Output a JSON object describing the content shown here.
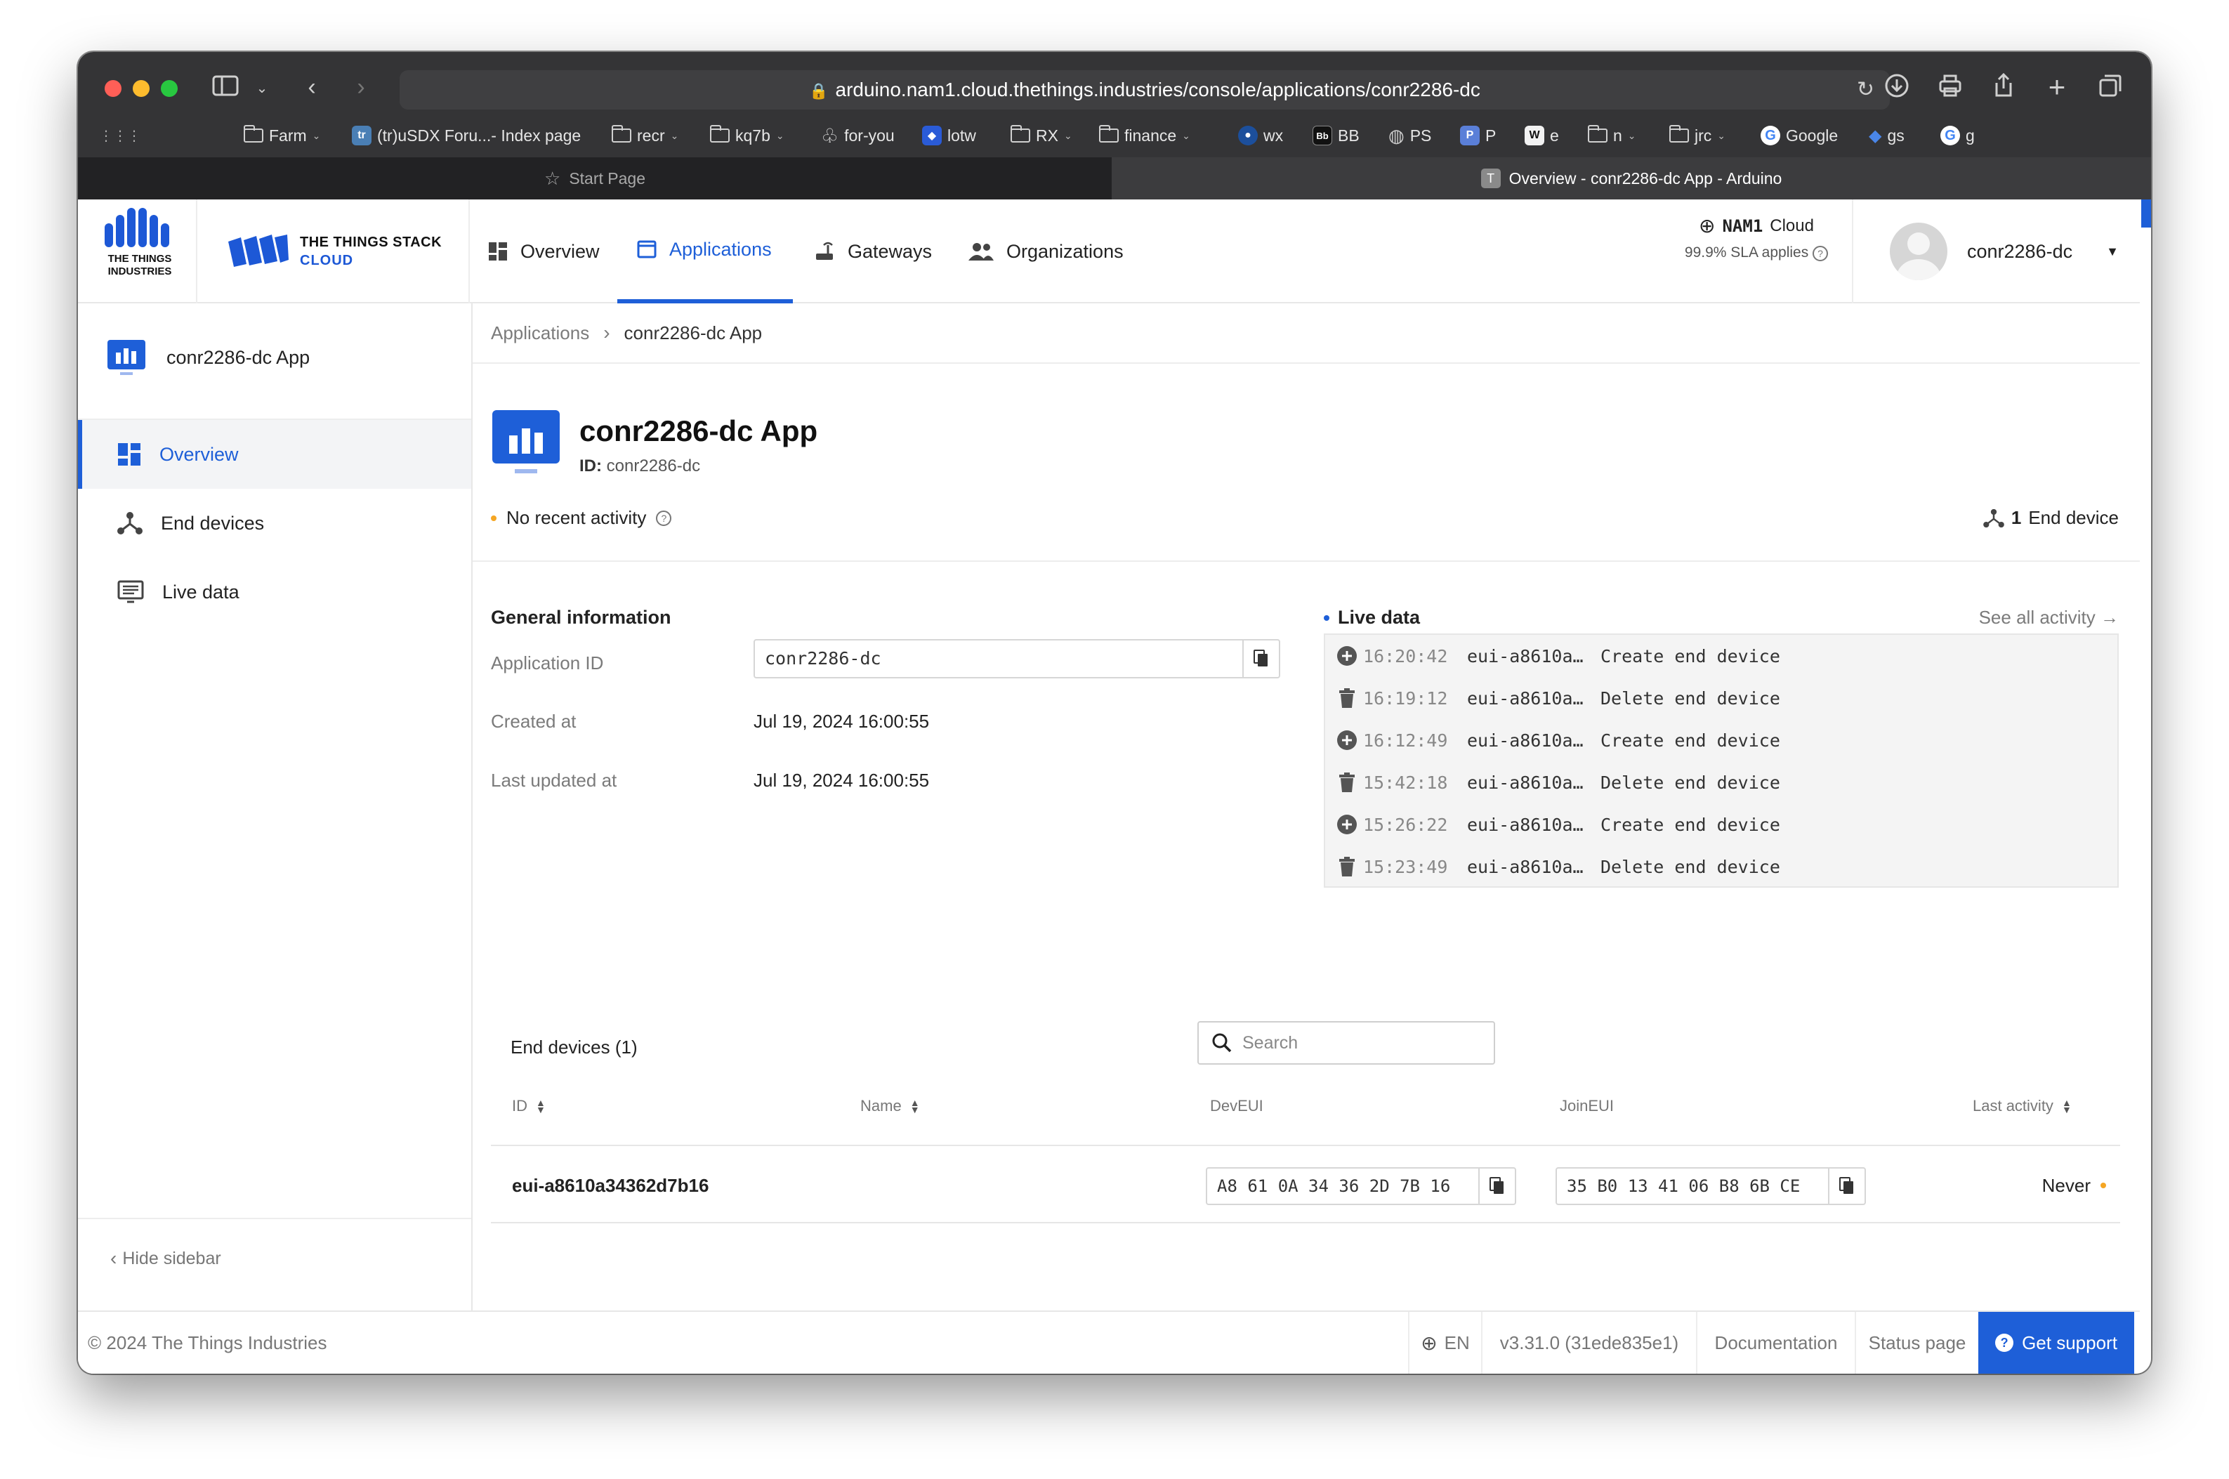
{
  "browser": {
    "url": "arduino.nam1.cloud.thethings.industries/console/applications/conr2286-dc",
    "bookmarks": [
      {
        "label": "Farm",
        "kind": "folder"
      },
      {
        "label": "(tr)uSDX Foru...- Index page",
        "kind": "site"
      },
      {
        "label": "recr",
        "kind": "folder"
      },
      {
        "label": "kq7b",
        "kind": "folder"
      },
      {
        "label": "for-you",
        "kind": "site"
      },
      {
        "label": "lotw",
        "kind": "site"
      },
      {
        "label": "RX",
        "kind": "folder"
      },
      {
        "label": "finance",
        "kind": "folder"
      },
      {
        "label": "wx",
        "kind": "site"
      },
      {
        "label": "BB",
        "kind": "site"
      },
      {
        "label": "PS",
        "kind": "site"
      },
      {
        "label": "P",
        "kind": "site"
      },
      {
        "label": "e",
        "kind": "site"
      },
      {
        "label": "n",
        "kind": "folder"
      },
      {
        "label": "jrc",
        "kind": "folder"
      },
      {
        "label": "Google",
        "kind": "site"
      },
      {
        "label": "gs",
        "kind": "site"
      },
      {
        "label": "g",
        "kind": "site"
      }
    ],
    "tabs": [
      {
        "label": "Start Page",
        "active": false
      },
      {
        "label": "Overview - conr2286-dc App - Arduino",
        "active": true,
        "favicon": "T"
      }
    ]
  },
  "header": {
    "brand_ttI": "THE THINGS INDUSTRIES",
    "brand_line1": "THE THINGS STACK",
    "brand_line2": "CLOUD",
    "nav": [
      {
        "label": "Overview",
        "icon": "grid-icon"
      },
      {
        "label": "Applications",
        "icon": "application-icon",
        "active": true
      },
      {
        "label": "Gateways",
        "icon": "gateway-icon"
      },
      {
        "label": "Organizations",
        "icon": "organizations-icon"
      }
    ],
    "cluster": "NAM1",
    "cluster_suffix": "Cloud",
    "sla": "99.9% SLA applies",
    "user": "conr2286-dc"
  },
  "sidebar": {
    "app_name": "conr2286-dc App",
    "items": [
      {
        "label": "Overview",
        "icon": "dashboard-icon",
        "active": true
      },
      {
        "label": "End devices",
        "icon": "end-devices-icon"
      },
      {
        "label": "Live data",
        "icon": "live-data-icon"
      }
    ],
    "hide": "Hide sidebar"
  },
  "main": {
    "breadcrumb": [
      "Applications",
      "conr2286-dc App"
    ],
    "title": "conr2286-dc App",
    "id_label": "ID:",
    "id_value": "conr2286-dc",
    "activity": "No recent activity",
    "end_device_count": "1",
    "end_device_count_label": "End device",
    "general": {
      "heading": "General information",
      "rows": [
        {
          "label": "Application ID",
          "value": "conr2286-dc"
        },
        {
          "label": "Created at",
          "value": "Jul 19, 2024 16:00:55"
        },
        {
          "label": "Last updated at",
          "value": "Jul 19, 2024 16:00:55"
        }
      ]
    },
    "live": {
      "heading": "Live data",
      "see_all": "See all activity →",
      "events": [
        {
          "time": "16:20:42",
          "device": "eui-a8610a…",
          "event": "Create end device",
          "icon": "plus-circle-icon"
        },
        {
          "time": "16:19:12",
          "device": "eui-a8610a…",
          "event": "Delete end device",
          "icon": "trash-icon"
        },
        {
          "time": "16:12:49",
          "device": "eui-a8610a…",
          "event": "Create end device",
          "icon": "plus-circle-icon"
        },
        {
          "time": "15:42:18",
          "device": "eui-a8610a…",
          "event": "Delete end device",
          "icon": "trash-icon"
        },
        {
          "time": "15:26:22",
          "device": "eui-a8610a…",
          "event": "Create end device",
          "icon": "plus-circle-icon"
        },
        {
          "time": "15:23:49",
          "device": "eui-a8610a…",
          "event": "Delete end device",
          "icon": "trash-icon"
        }
      ]
    },
    "end_devices": {
      "heading": "End devices (1)",
      "search_placeholder": "Search",
      "columns": [
        "ID",
        "Name",
        "DevEUI",
        "JoinEUI",
        "Last activity"
      ],
      "rows": [
        {
          "id": "eui-a8610a34362d7b16",
          "name": "",
          "dev_eui": "A8 61 0A 34 36 2D 7B 16",
          "join_eui": "35 B0 13 41 06 B8 6B CE",
          "last_activity": "Never"
        }
      ]
    }
  },
  "footer": {
    "copyright": "© 2024 The Things Industries",
    "lang": "EN",
    "version": "v3.31.0 (31ede835e1)",
    "docs": "Documentation",
    "status": "Status page",
    "support": "Get support"
  },
  "colors": {
    "accent": "#1e5fd8",
    "activity_dot": "#f5a623",
    "chrome": "#343436"
  }
}
